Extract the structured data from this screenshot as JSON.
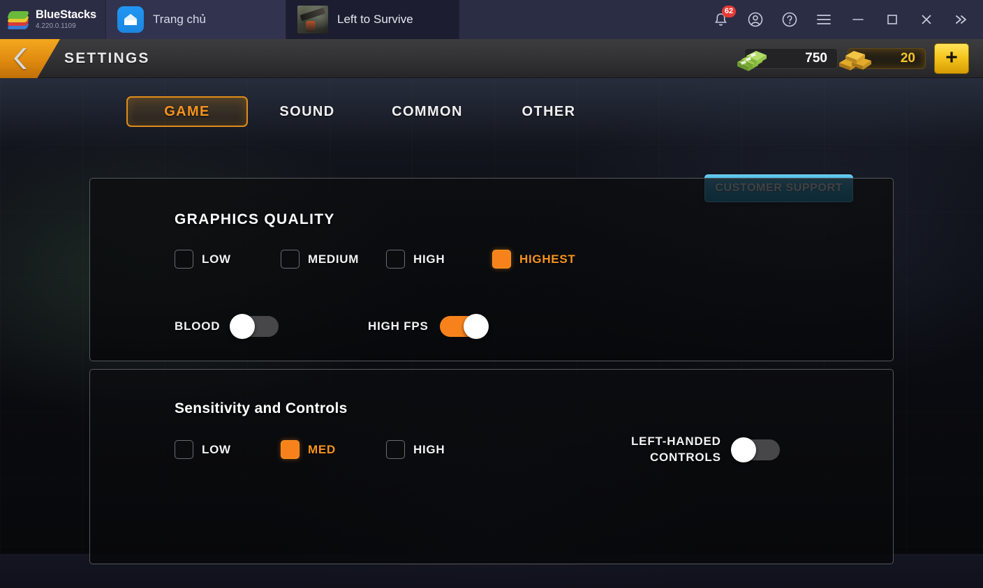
{
  "window": {
    "brand": {
      "name": "BlueStacks",
      "version": "4.220.0.1109",
      "icon": "bluestacks-logo-icon"
    },
    "tabs": [
      {
        "label": "Trang chủ",
        "icon": "home-icon",
        "active": false
      },
      {
        "label": "Left to Survive",
        "icon": "game-thumbnail-icon",
        "active": true
      }
    ],
    "controls": [
      {
        "name": "notifications-icon",
        "badge": "62"
      },
      {
        "name": "account-icon"
      },
      {
        "name": "help-icon"
      },
      {
        "name": "menu-icon"
      },
      {
        "name": "minimize-icon"
      },
      {
        "name": "maximize-icon"
      },
      {
        "name": "close-icon"
      },
      {
        "name": "expand-icon"
      }
    ]
  },
  "header": {
    "title": "SETTINGS",
    "back_icon": "back-chevron-icon",
    "currencies": [
      {
        "id": "cash",
        "value": "750",
        "icon": "cash-stack-icon"
      },
      {
        "id": "gold",
        "value": "20",
        "icon": "gold-bars-icon"
      }
    ],
    "add_label": "+"
  },
  "nav": {
    "tabs": [
      {
        "label": "GAME",
        "active": true
      },
      {
        "label": "SOUND",
        "active": false
      },
      {
        "label": "COMMON",
        "active": false
      },
      {
        "label": "OTHER",
        "active": false
      }
    ],
    "support_label": "CUSTOMER SUPPORT"
  },
  "graphics": {
    "title": "GRAPHICS QUALITY",
    "options": [
      {
        "label": "LOW",
        "checked": false
      },
      {
        "label": "MEDIUM",
        "checked": false
      },
      {
        "label": "HIGH",
        "checked": false
      },
      {
        "label": "HIGHEST",
        "checked": true
      }
    ],
    "toggles": [
      {
        "label": "BLOOD",
        "on": false
      },
      {
        "label": "HIGH FPS",
        "on": true
      }
    ]
  },
  "sensitivity": {
    "title": "Sensitivity and Controls",
    "options": [
      {
        "label": "LOW",
        "checked": false
      },
      {
        "label": "MED",
        "checked": true
      },
      {
        "label": "HIGH",
        "checked": false
      }
    ],
    "toggle": {
      "label_line1": "LEFT-HANDED",
      "label_line2": "CONTROLS",
      "on": false
    }
  },
  "colors": {
    "accent_orange": "#f7821b",
    "accent_gold": "#f5c526",
    "support_blue": "#28a9dd",
    "badge_red": "#e53935"
  }
}
